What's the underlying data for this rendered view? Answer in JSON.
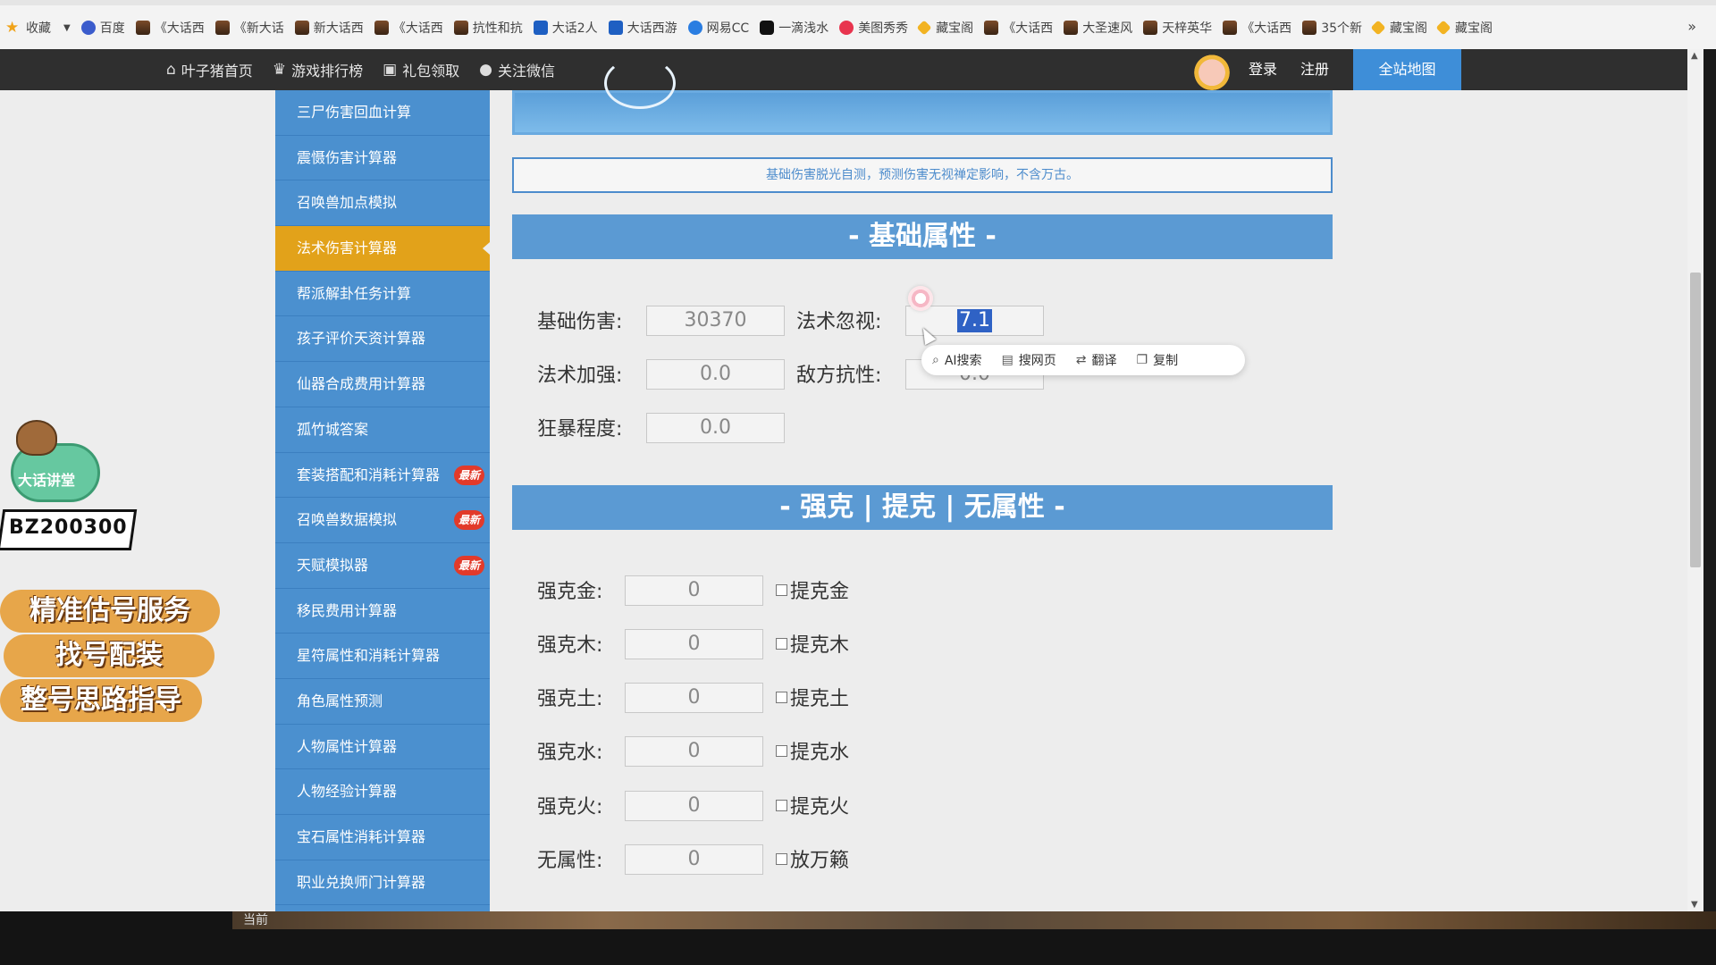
{
  "bookmarks": [
    {
      "label": "收藏",
      "icon": "star-icon"
    },
    {
      "label": "百度",
      "icon": "baidu-paw-icon"
    },
    {
      "label": "《大话西",
      "icon": "game-icon"
    },
    {
      "label": "《新大话",
      "icon": "game-icon"
    },
    {
      "label": "新大话西",
      "icon": "game-icon"
    },
    {
      "label": "《大话西",
      "icon": "game-icon"
    },
    {
      "label": "抗性和抗",
      "icon": "game-icon"
    },
    {
      "label": "大话2人",
      "icon": "dahua-icon"
    },
    {
      "label": "大话西游",
      "icon": "dahua-icon"
    },
    {
      "label": "网易CC",
      "icon": "netease-cc-icon"
    },
    {
      "label": "一滴浅水",
      "icon": "tiktok-icon"
    },
    {
      "label": "美图秀秀",
      "icon": "meitu-icon"
    },
    {
      "label": "藏宝阁",
      "icon": "cangbaoge-icon"
    },
    {
      "label": "《大话西",
      "icon": "game-icon"
    },
    {
      "label": "大圣速风",
      "icon": "game-icon"
    },
    {
      "label": "天梓英华",
      "icon": "game-icon"
    },
    {
      "label": "《大话西",
      "icon": "game-icon"
    },
    {
      "label": "35个新",
      "icon": "game-icon"
    },
    {
      "label": "藏宝阁",
      "icon": "cangbaoge-icon"
    },
    {
      "label": "藏宝阁",
      "icon": "cangbaoge-icon"
    }
  ],
  "bookmarks_more": "»",
  "nav": {
    "items": [
      {
        "label": "叶子猪首页",
        "icon": "home-icon"
      },
      {
        "label": "游戏排行榜",
        "icon": "crown-icon"
      },
      {
        "label": "礼包领取",
        "icon": "gift-icon"
      },
      {
        "label": "关注微信",
        "icon": "wechat-icon"
      }
    ],
    "login": "登录",
    "register": "注册",
    "sitemap": "全站地图"
  },
  "promo": {
    "cloud_label": "大话讲堂",
    "code": "BZ200300",
    "lines": [
      "精准估号服务",
      "找号配装",
      "整号思路指导"
    ]
  },
  "sidebar": {
    "items": [
      {
        "label": "三尸伤害回血计算"
      },
      {
        "label": "震慑伤害计算器"
      },
      {
        "label": "召唤兽加点模拟"
      },
      {
        "label": "法术伤害计算器",
        "active": true
      },
      {
        "label": "帮派解卦任务计算"
      },
      {
        "label": "孩子评价天资计算器"
      },
      {
        "label": "仙器合成费用计算器"
      },
      {
        "label": "孤竹城答案"
      },
      {
        "label": "套装搭配和消耗计算器",
        "badge": "最新"
      },
      {
        "label": "召唤兽数据模拟",
        "badge": "最新"
      },
      {
        "label": "天赋模拟器",
        "badge": "最新"
      },
      {
        "label": "移民费用计算器"
      },
      {
        "label": "星符属性和消耗计算器"
      },
      {
        "label": "角色属性预测"
      },
      {
        "label": "人物属性计算器"
      },
      {
        "label": "人物经验计算器"
      },
      {
        "label": "宝石属性消耗计算器"
      },
      {
        "label": "职业兑换师门计算器"
      }
    ]
  },
  "main": {
    "notice": "基础伤害脱光自测，预测伤害无视禅定影响，不含万古。",
    "section1": {
      "title": "- 基础属性 -",
      "fields": {
        "base_damage": {
          "label": "基础伤害:",
          "value": "30370"
        },
        "ignore": {
          "label": "法术忽视:",
          "value": "7.1"
        },
        "enhance": {
          "label": "法术加强:",
          "value": "0.0"
        },
        "resist": {
          "label": "敌方抗性:",
          "value": "0.0"
        },
        "crit": {
          "label": "狂暴程度:",
          "value": "0.0"
        }
      }
    },
    "section2": {
      "title": "- 强克 | 提克 | 无属性 -",
      "rows": [
        {
          "label": "强克金:",
          "value": "0",
          "check_label": "提克金"
        },
        {
          "label": "强克木:",
          "value": "0",
          "check_label": "提克木"
        },
        {
          "label": "强克土:",
          "value": "0",
          "check_label": "提克土"
        },
        {
          "label": "强克水:",
          "value": "0",
          "check_label": "提克水"
        },
        {
          "label": "强克火:",
          "value": "0",
          "check_label": "提克火"
        },
        {
          "label": "无属性:",
          "value": "0",
          "check_label": "放万籁"
        }
      ]
    }
  },
  "context_menu": {
    "items": [
      {
        "label": "AI搜索",
        "icon": "search-icon"
      },
      {
        "label": "搜网页",
        "icon": "web-search-icon"
      },
      {
        "label": "翻译",
        "icon": "translate-icon"
      },
      {
        "label": "复制",
        "icon": "copy-icon"
      }
    ]
  },
  "taskbar": {
    "game_label": "当前"
  }
}
